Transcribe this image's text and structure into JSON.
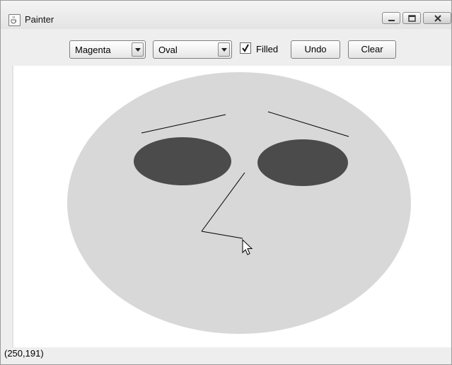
{
  "window": {
    "title": "Painter",
    "icon": "java-cup-icon",
    "controls": [
      "minimize-icon",
      "maximize-icon",
      "close-icon"
    ]
  },
  "toolbar": {
    "color_select": {
      "selected": "Magenta",
      "icon": "chevron-down-icon"
    },
    "shape_select": {
      "selected": "Oval",
      "icon": "chevron-down-icon"
    },
    "filled": {
      "label": "Filled",
      "checked": true
    },
    "undo_label": "Undo",
    "clear_label": "Clear"
  },
  "canvas": {
    "background": "#ffffff",
    "face_fill": "#d8d8d8",
    "eye_fill": "#4b4b4b",
    "line_color": "#000000",
    "cursor": "arrow-cursor-icon"
  },
  "status": {
    "coordinates": "(250,191)"
  }
}
